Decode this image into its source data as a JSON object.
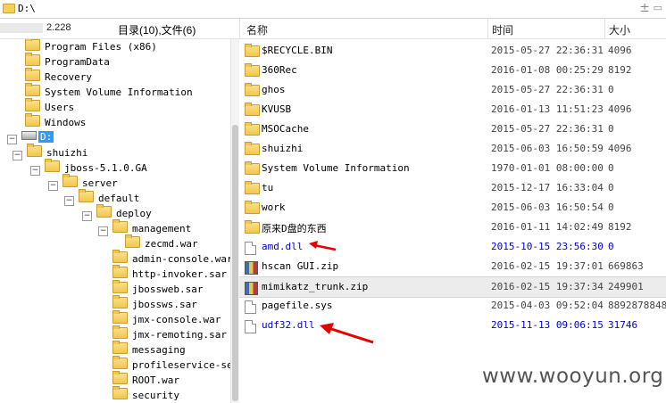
{
  "path_bar": {
    "path": "D:\\",
    "up_icon": "up-arrow-icon",
    "dropdown_icon": "dropdown-icon"
  },
  "header": {
    "ip_suffix": "2.228",
    "summary": "目录(10),文件(6)",
    "col_name": "名称",
    "col_time": "时间",
    "col_size": "大小"
  },
  "tree": [
    {
      "label": "Program Files (x86)",
      "icon": "folder-icon"
    },
    {
      "label": "ProgramData",
      "icon": "folder-icon"
    },
    {
      "label": "Recovery",
      "icon": "folder-icon"
    },
    {
      "label": "System Volume Information",
      "icon": "folder-icon"
    },
    {
      "label": "Users",
      "icon": "folder-icon"
    },
    {
      "label": "Windows",
      "icon": "folder-icon"
    },
    {
      "label": "D:",
      "icon": "drive-icon",
      "toggle": "−"
    },
    {
      "label": "shuizhi",
      "icon": "folder-icon",
      "toggle": "−"
    },
    {
      "label": "jboss-5.1.0.GA",
      "icon": "folder-icon",
      "toggle": "−"
    },
    {
      "label": "server",
      "icon": "folder-icon",
      "toggle": "−"
    },
    {
      "label": "default",
      "icon": "folder-icon",
      "toggle": "−"
    },
    {
      "label": "deploy",
      "icon": "folder-icon",
      "toggle": "−"
    },
    {
      "label": "management",
      "icon": "folder-icon",
      "toggle": "−"
    },
    {
      "label": "zecmd.war",
      "icon": "folder-icon"
    },
    {
      "label": "admin-console.war",
      "icon": "folder-icon"
    },
    {
      "label": "http-invoker.sar",
      "icon": "folder-icon"
    },
    {
      "label": "jbossweb.sar",
      "icon": "folder-icon"
    },
    {
      "label": "jbossws.sar",
      "icon": "folder-icon"
    },
    {
      "label": "jmx-console.war",
      "icon": "folder-icon"
    },
    {
      "label": "jmx-remoting.sar",
      "icon": "folder-icon"
    },
    {
      "label": "messaging",
      "icon": "folder-icon"
    },
    {
      "label": "profileservice-secu",
      "icon": "folder-icon"
    },
    {
      "label": "ROOT.war",
      "icon": "folder-icon"
    },
    {
      "label": "security",
      "icon": "folder-icon"
    }
  ],
  "files": [
    {
      "name": "$RECYCLE.BIN",
      "time": "2015-05-27 22:36:31",
      "size": "4096",
      "icon": "folder-icon"
    },
    {
      "name": "360Rec",
      "time": "2016-01-08 00:25:29",
      "size": "8192",
      "icon": "folder-icon"
    },
    {
      "name": "ghos",
      "time": "2015-05-27 22:36:31",
      "size": "0",
      "icon": "folder-icon"
    },
    {
      "name": "KVUSB",
      "time": "2016-01-13 11:51:23",
      "size": "4096",
      "icon": "folder-icon"
    },
    {
      "name": "MSOCache",
      "time": "2015-05-27 22:36:31",
      "size": "0",
      "icon": "folder-icon"
    },
    {
      "name": "shuizhi",
      "time": "2015-06-03 16:50:59",
      "size": "4096",
      "icon": "folder-icon"
    },
    {
      "name": "System Volume Information",
      "time": "1970-01-01 08:00:00",
      "size": "0",
      "icon": "folder-icon"
    },
    {
      "name": "tu",
      "time": "2015-12-17 16:33:04",
      "size": "0",
      "icon": "folder-icon"
    },
    {
      "name": "work",
      "time": "2015-06-03 16:50:54",
      "size": "0",
      "icon": "folder-icon"
    },
    {
      "name": "原来D盘的东西",
      "time": "2016-01-11 14:02:49",
      "size": "8192",
      "icon": "folder-icon"
    },
    {
      "name": "amd.dll",
      "time": "2015-10-15 23:56:30",
      "size": "0",
      "icon": "file-icon"
    },
    {
      "name": "hscan GUI.zip",
      "time": "2016-02-15 19:37:01",
      "size": "669863",
      "icon": "zip-icon"
    },
    {
      "name": "mimikatz_trunk.zip",
      "time": "2016-02-15 19:37:34",
      "size": "249901",
      "icon": "zip-icon"
    },
    {
      "name": "pagefile.sys",
      "time": "2015-04-03 09:52:04",
      "size": "8892878848",
      "icon": "file-icon"
    },
    {
      "name": "udf32.dll",
      "time": "2015-11-13 09:06:15",
      "size": "31746",
      "icon": "file-icon"
    }
  ],
  "annotations": {
    "arrow_color": "#e60000",
    "highlight_color": "#0000cc",
    "selection_color": "#ececec"
  },
  "watermark": "www.wooyun.org"
}
